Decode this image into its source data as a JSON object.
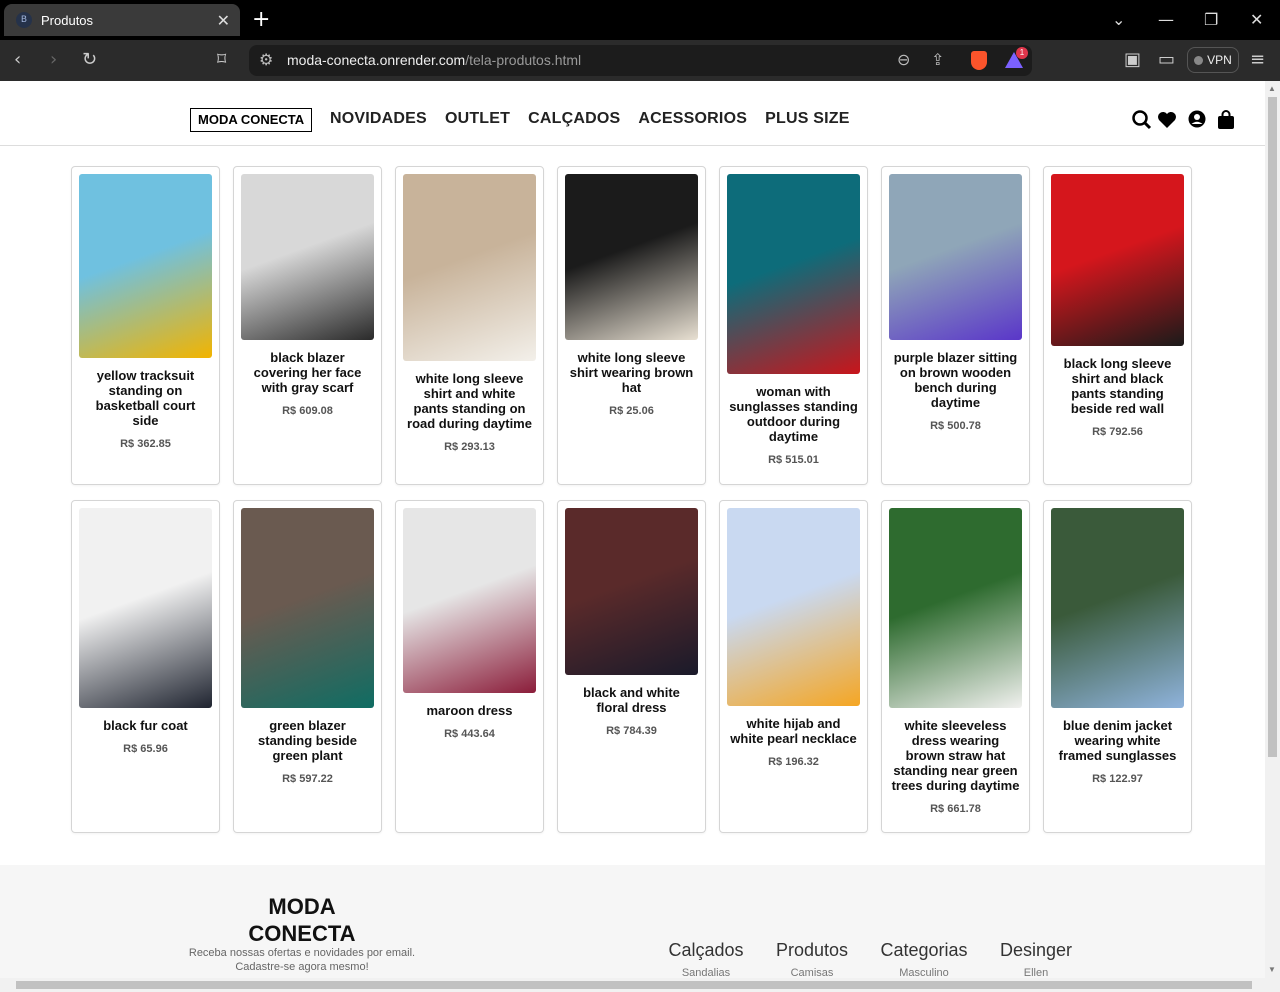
{
  "browser": {
    "tab_title": "Produtos",
    "url_host": "moda-conecta.onrender.com",
    "url_path": "/tela-produtos.html",
    "vpn_label": "VPN",
    "rewards_count": "1"
  },
  "header": {
    "logo": "MODA CONECTA",
    "nav": [
      "NOVIDADES",
      "OUTLET",
      "CALÇADOS",
      "ACESSORIOS",
      "PLUS SIZE"
    ]
  },
  "products": [
    {
      "title": "yellow tracksuit standing on basketball court side",
      "price": "R$ 362.85",
      "colors": [
        "#6fc1e0",
        "#f2b400"
      ]
    },
    {
      "title": "black blazer covering her face with gray scarf",
      "price": "R$ 609.08",
      "colors": [
        "#d8d8d8",
        "#2a2a2a"
      ]
    },
    {
      "title": "white long sleeve shirt and white pants standing on road during daytime",
      "price": "R$ 293.13",
      "colors": [
        "#c8b39a",
        "#f3f0ea"
      ]
    },
    {
      "title": "white long sleeve shirt wearing brown hat",
      "price": "R$ 25.06",
      "colors": [
        "#1b1b1b",
        "#e8e0d2"
      ]
    },
    {
      "title": "woman with sunglasses standing outdoor during daytime",
      "price": "R$ 515.01",
      "colors": [
        "#0d6c7a",
        "#c9151b"
      ]
    },
    {
      "title": "purple blazer sitting on brown wooden bench during daytime",
      "price": "R$ 500.78",
      "colors": [
        "#8fa6b8",
        "#5a36c9"
      ]
    },
    {
      "title": "black long sleeve shirt and black pants standing beside red wall",
      "price": "R$ 792.56",
      "colors": [
        "#d5161c",
        "#1a1a1a"
      ]
    },
    {
      "title": "black fur coat",
      "price": "R$ 65.96",
      "colors": [
        "#f1f1f1",
        "#1f2430"
      ]
    },
    {
      "title": "green blazer standing beside green plant",
      "price": "R$ 597.22",
      "colors": [
        "#6a5a50",
        "#0f6d63"
      ]
    },
    {
      "title": "maroon dress",
      "price": "R$ 443.64",
      "colors": [
        "#e6e6e6",
        "#8b1d3a"
      ]
    },
    {
      "title": "black and white floral dress",
      "price": "R$ 784.39",
      "colors": [
        "#5a2a2a",
        "#1a1a2a"
      ]
    },
    {
      "title": "white hijab and white pearl necklace",
      "price": "R$ 196.32",
      "colors": [
        "#c9d9f1",
        "#f5a623"
      ]
    },
    {
      "title": "white sleeveless dress wearing brown straw hat standing near green trees during daytime",
      "price": "R$ 661.78",
      "colors": [
        "#2e6b2f",
        "#f1f1ef"
      ]
    },
    {
      "title": "blue denim jacket wearing white framed sunglasses",
      "price": "R$ 122.97",
      "colors": [
        "#3a5a3a",
        "#8fb3dc"
      ]
    }
  ],
  "footer": {
    "brand": "MODA CONECTA",
    "tagline": "Receba nossas ofertas e novidades por email. Cadastre-se agora mesmo!",
    "columns": [
      {
        "title": "Calçados",
        "item": "Sandalias"
      },
      {
        "title": "Produtos",
        "item": "Camisas"
      },
      {
        "title": "Categorias",
        "item": "Masculino"
      },
      {
        "title": "Desinger",
        "item": "Ellen"
      }
    ]
  }
}
